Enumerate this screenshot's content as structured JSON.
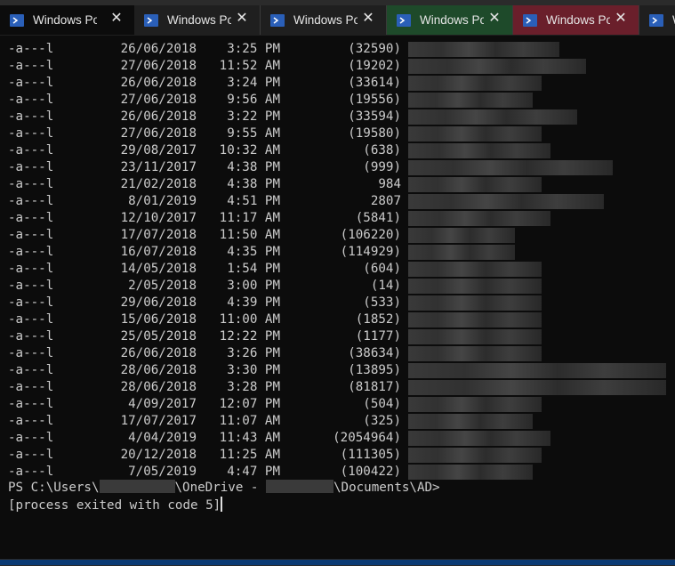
{
  "tabs": [
    {
      "title": "Windows PowerShell",
      "state": "active"
    },
    {
      "title": "Windows PowerShell",
      "state": "normal"
    },
    {
      "title": "Windows PowerShell",
      "state": "normal"
    },
    {
      "title": "Windows PowerShell",
      "state": "green"
    },
    {
      "title": "Windows PowerShell",
      "state": "red"
    },
    {
      "title": "W",
      "state": "partial"
    }
  ],
  "listing": [
    {
      "mode": "-a---l",
      "date": "26/06/2018",
      "time": "3:25 PM",
      "length": "(32590)"
    },
    {
      "mode": "-a---l",
      "date": "27/06/2018",
      "time": "11:52 AM",
      "length": "(19202)"
    },
    {
      "mode": "-a---l",
      "date": "26/06/2018",
      "time": "3:24 PM",
      "length": "(33614)"
    },
    {
      "mode": "-a---l",
      "date": "27/06/2018",
      "time": "9:56 AM",
      "length": "(19556)"
    },
    {
      "mode": "-a---l",
      "date": "26/06/2018",
      "time": "3:22 PM",
      "length": "(33594)"
    },
    {
      "mode": "-a---l",
      "date": "27/06/2018",
      "time": "9:55 AM",
      "length": "(19580)"
    },
    {
      "mode": "-a---l",
      "date": "29/08/2017",
      "time": "10:32 AM",
      "length": "(638)"
    },
    {
      "mode": "-a---l",
      "date": "23/11/2017",
      "time": "4:38 PM",
      "length": "(999)"
    },
    {
      "mode": "-a---l",
      "date": "21/02/2018",
      "time": "4:38 PM",
      "length": "984"
    },
    {
      "mode": "-a---l",
      "date": "8/01/2019",
      "time": "4:51 PM",
      "length": "2807"
    },
    {
      "mode": "-a---l",
      "date": "12/10/2017",
      "time": "11:17 AM",
      "length": "(5841)"
    },
    {
      "mode": "-a---l",
      "date": "17/07/2018",
      "time": "11:50 AM",
      "length": "(106220)"
    },
    {
      "mode": "-a---l",
      "date": "16/07/2018",
      "time": "4:35 PM",
      "length": "(114929)"
    },
    {
      "mode": "-a---l",
      "date": "14/05/2018",
      "time": "1:54 PM",
      "length": "(604)"
    },
    {
      "mode": "-a---l",
      "date": "2/05/2018",
      "time": "3:00 PM",
      "length": "(14)"
    },
    {
      "mode": "-a---l",
      "date": "29/06/2018",
      "time": "4:39 PM",
      "length": "(533)"
    },
    {
      "mode": "-a---l",
      "date": "15/06/2018",
      "time": "11:00 AM",
      "length": "(1852)"
    },
    {
      "mode": "-a---l",
      "date": "25/05/2018",
      "time": "12:22 PM",
      "length": "(1177)"
    },
    {
      "mode": "-a---l",
      "date": "26/06/2018",
      "time": "3:26 PM",
      "length": "(38634)"
    },
    {
      "mode": "-a---l",
      "date": "28/06/2018",
      "time": "3:30 PM",
      "length": "(13895)"
    },
    {
      "mode": "-a---l",
      "date": "28/06/2018",
      "time": "3:28 PM",
      "length": "(81817)"
    },
    {
      "mode": "-a---l",
      "date": "4/09/2017",
      "time": "12:07 PM",
      "length": "(504)"
    },
    {
      "mode": "-a---l",
      "date": "17/07/2017",
      "time": "11:07 AM",
      "length": "(325)"
    },
    {
      "mode": "-a---l",
      "date": "4/04/2019",
      "time": "11:43 AM",
      "length": "(2054964)"
    },
    {
      "mode": "-a---l",
      "date": "20/12/2018",
      "time": "11:25 AM",
      "length": "(111305)"
    },
    {
      "mode": "-a---l",
      "date": "7/05/2019",
      "time": "4:47 PM",
      "length": "(100422)"
    }
  ],
  "prompt": {
    "prefix": "PS C:\\Users\\",
    "middle": "\\OneDrive - ",
    "suffix": "\\Documents\\AD>"
  },
  "exit_message": "[process exited with code 5]",
  "colors": {
    "terminal_bg": "#0c0c0c",
    "text": "#cccccc",
    "tab_green": "#1e4a2a",
    "tab_red": "#6a1f2b"
  }
}
